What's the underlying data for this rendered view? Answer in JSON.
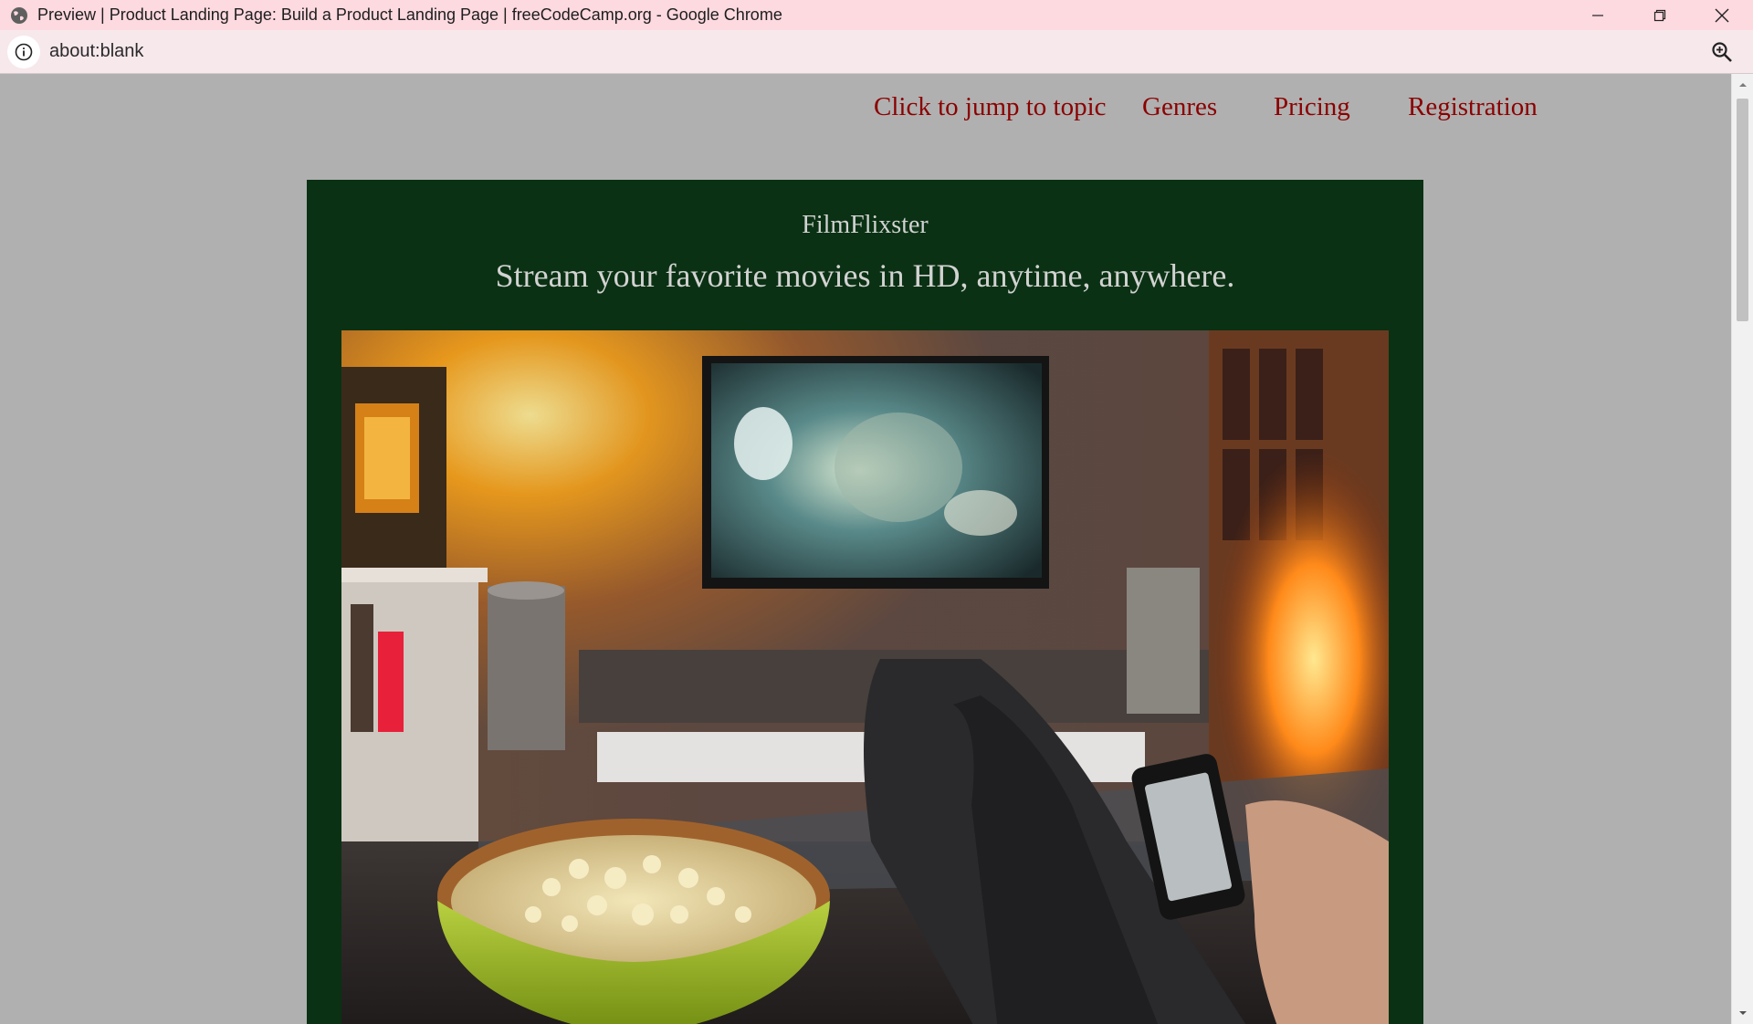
{
  "window": {
    "title": "Preview | Product Landing Page: Build a Product Landing Page | freeCodeCamp.org - Google Chrome"
  },
  "address_bar": {
    "url": "about:blank"
  },
  "nav": {
    "jump": "Click to jump to topic",
    "genres": "Genres",
    "pricing": "Pricing",
    "registration": "Registration"
  },
  "hero": {
    "brand": "FilmFlixster",
    "tagline": "Stream your favorite movies in HD, anytime, anywhere."
  },
  "colors": {
    "titlebar": "#fdd9e0",
    "page_bg": "#b0b0b0",
    "hero_bg": "#0a3113",
    "nav_link": "#8b0000",
    "hero_text": "#d2d2d2"
  },
  "icons": {
    "app": "globe-icon",
    "minimize": "minimize-icon",
    "restore": "restore-icon",
    "close": "close-icon",
    "site_info": "info-icon",
    "zoom": "zoom-icon"
  }
}
